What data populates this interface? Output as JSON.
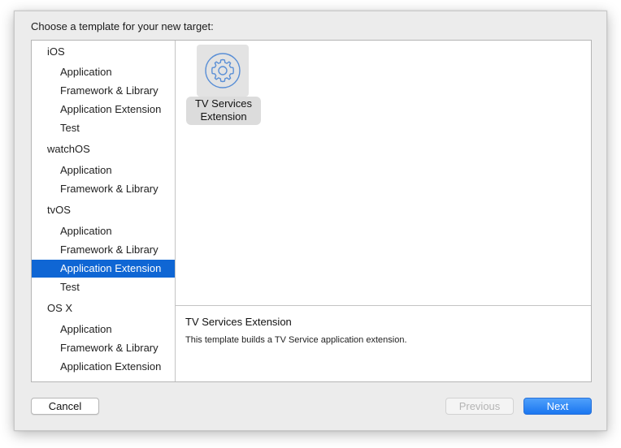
{
  "dialog": {
    "prompt": "Choose a template for your new target:"
  },
  "sidebar": {
    "items": [
      {
        "label": "iOS",
        "kind": "platform"
      },
      {
        "label": "Application",
        "kind": "sub"
      },
      {
        "label": "Framework & Library",
        "kind": "sub"
      },
      {
        "label": "Application Extension",
        "kind": "sub"
      },
      {
        "label": "Test",
        "kind": "sub"
      },
      {
        "label": "watchOS",
        "kind": "platform"
      },
      {
        "label": "Application",
        "kind": "sub"
      },
      {
        "label": "Framework & Library",
        "kind": "sub"
      },
      {
        "label": "tvOS",
        "kind": "platform"
      },
      {
        "label": "Application",
        "kind": "sub"
      },
      {
        "label": "Framework & Library",
        "kind": "sub"
      },
      {
        "label": "Application Extension",
        "kind": "sub",
        "selected": true
      },
      {
        "label": "Test",
        "kind": "sub"
      },
      {
        "label": "OS X",
        "kind": "platform"
      },
      {
        "label": "Application",
        "kind": "sub"
      },
      {
        "label": "Framework & Library",
        "kind": "sub"
      },
      {
        "label": "Application Extension",
        "kind": "sub"
      }
    ]
  },
  "templates": [
    {
      "line1": "TV Services",
      "line2": "Extension",
      "icon": "gear-icon",
      "selected": true
    }
  ],
  "description": {
    "title": "TV Services Extension",
    "text": "This template builds a TV Service application extension."
  },
  "buttons": {
    "cancel": "Cancel",
    "previous": "Previous",
    "next": "Next"
  },
  "colors": {
    "selection": "#0f66d4",
    "primary_button": "#1a76f0",
    "icon_stroke": "#5a8fd6"
  }
}
